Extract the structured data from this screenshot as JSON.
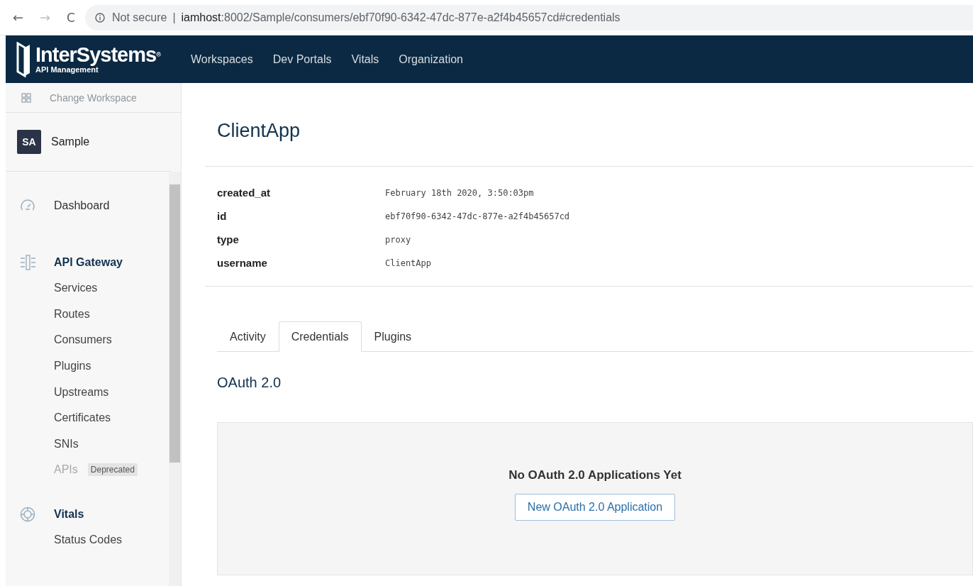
{
  "browser": {
    "back": "←",
    "forward": "→",
    "reload": "C",
    "forward_disabled": true,
    "security": "Not secure",
    "separator": "|",
    "url_host": "iamhost",
    "url_rest": ":8002/Sample/consumers/ebf70f90-6342-47dc-877e-a2f4b45657cd#credentials"
  },
  "header": {
    "brand": "InterSystems",
    "brand_mark": "®",
    "subtitle": "API Management",
    "nav": [
      {
        "label": "Workspaces",
        "selected": false
      },
      {
        "label": "Dev Portals",
        "selected": false
      },
      {
        "label": "Vitals",
        "selected": false
      },
      {
        "label": "Organization",
        "selected": false
      }
    ]
  },
  "sidebar": {
    "change_workspace": "Change Workspace",
    "workspace": {
      "initials": "SA",
      "name": "Sample"
    },
    "sections": [
      {
        "title": "Dashboard"
      },
      {
        "title": "API Gateway",
        "children": [
          {
            "label": "Services",
            "disabled": false
          },
          {
            "label": "Routes",
            "disabled": false
          },
          {
            "label": "Consumers",
            "disabled": false
          },
          {
            "label": "Plugins",
            "disabled": false
          },
          {
            "label": "Upstreams",
            "disabled": false
          },
          {
            "label": "Certificates",
            "disabled": false
          },
          {
            "label": "SNIs",
            "disabled": false
          },
          {
            "label": "APIs",
            "disabled": true,
            "badge": "Deprecated"
          }
        ]
      },
      {
        "title": "Vitals",
        "children": [
          {
            "label": "Status Codes",
            "disabled": false
          }
        ]
      }
    ]
  },
  "main": {
    "title": "ClientApp",
    "fields": [
      {
        "key": "created_at",
        "value": "February 18th 2020, 3:50:03pm"
      },
      {
        "key": "id",
        "value": "ebf70f90-6342-47dc-877e-a2f4b45657cd"
      },
      {
        "key": "type",
        "value": "proxy"
      },
      {
        "key": "username",
        "value": "ClientApp"
      }
    ],
    "tabs": [
      {
        "label": "Activity",
        "selected": false
      },
      {
        "label": "Credentials",
        "selected": true
      },
      {
        "label": "Plugins",
        "selected": false
      }
    ],
    "section_title": "OAuth 2.0",
    "empty_message": "No OAuth 2.0 Applications Yet",
    "new_button": "New OAuth 2.0 Application"
  }
}
